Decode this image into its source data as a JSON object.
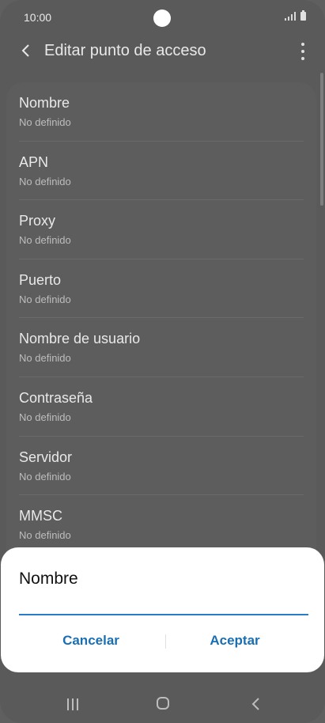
{
  "status_bar": {
    "time": "10:00"
  },
  "app_bar": {
    "title": "Editar punto de acceso"
  },
  "settings": [
    {
      "title": "Nombre",
      "value": "No definido"
    },
    {
      "title": "APN",
      "value": "No definido"
    },
    {
      "title": "Proxy",
      "value": "No definido"
    },
    {
      "title": "Puerto",
      "value": "No definido"
    },
    {
      "title": "Nombre de usuario",
      "value": "No definido"
    },
    {
      "title": "Contraseña",
      "value": "No definido"
    },
    {
      "title": "Servidor",
      "value": "No definido"
    },
    {
      "title": "MMSC",
      "value": "No definido"
    }
  ],
  "dialog": {
    "title": "Nombre",
    "input_value": "",
    "cancel_label": "Cancelar",
    "accept_label": "Aceptar",
    "accent_color": "#1a6fb3"
  },
  "navigation": {
    "icons": [
      "recents-icon",
      "home-icon",
      "back-icon"
    ]
  }
}
